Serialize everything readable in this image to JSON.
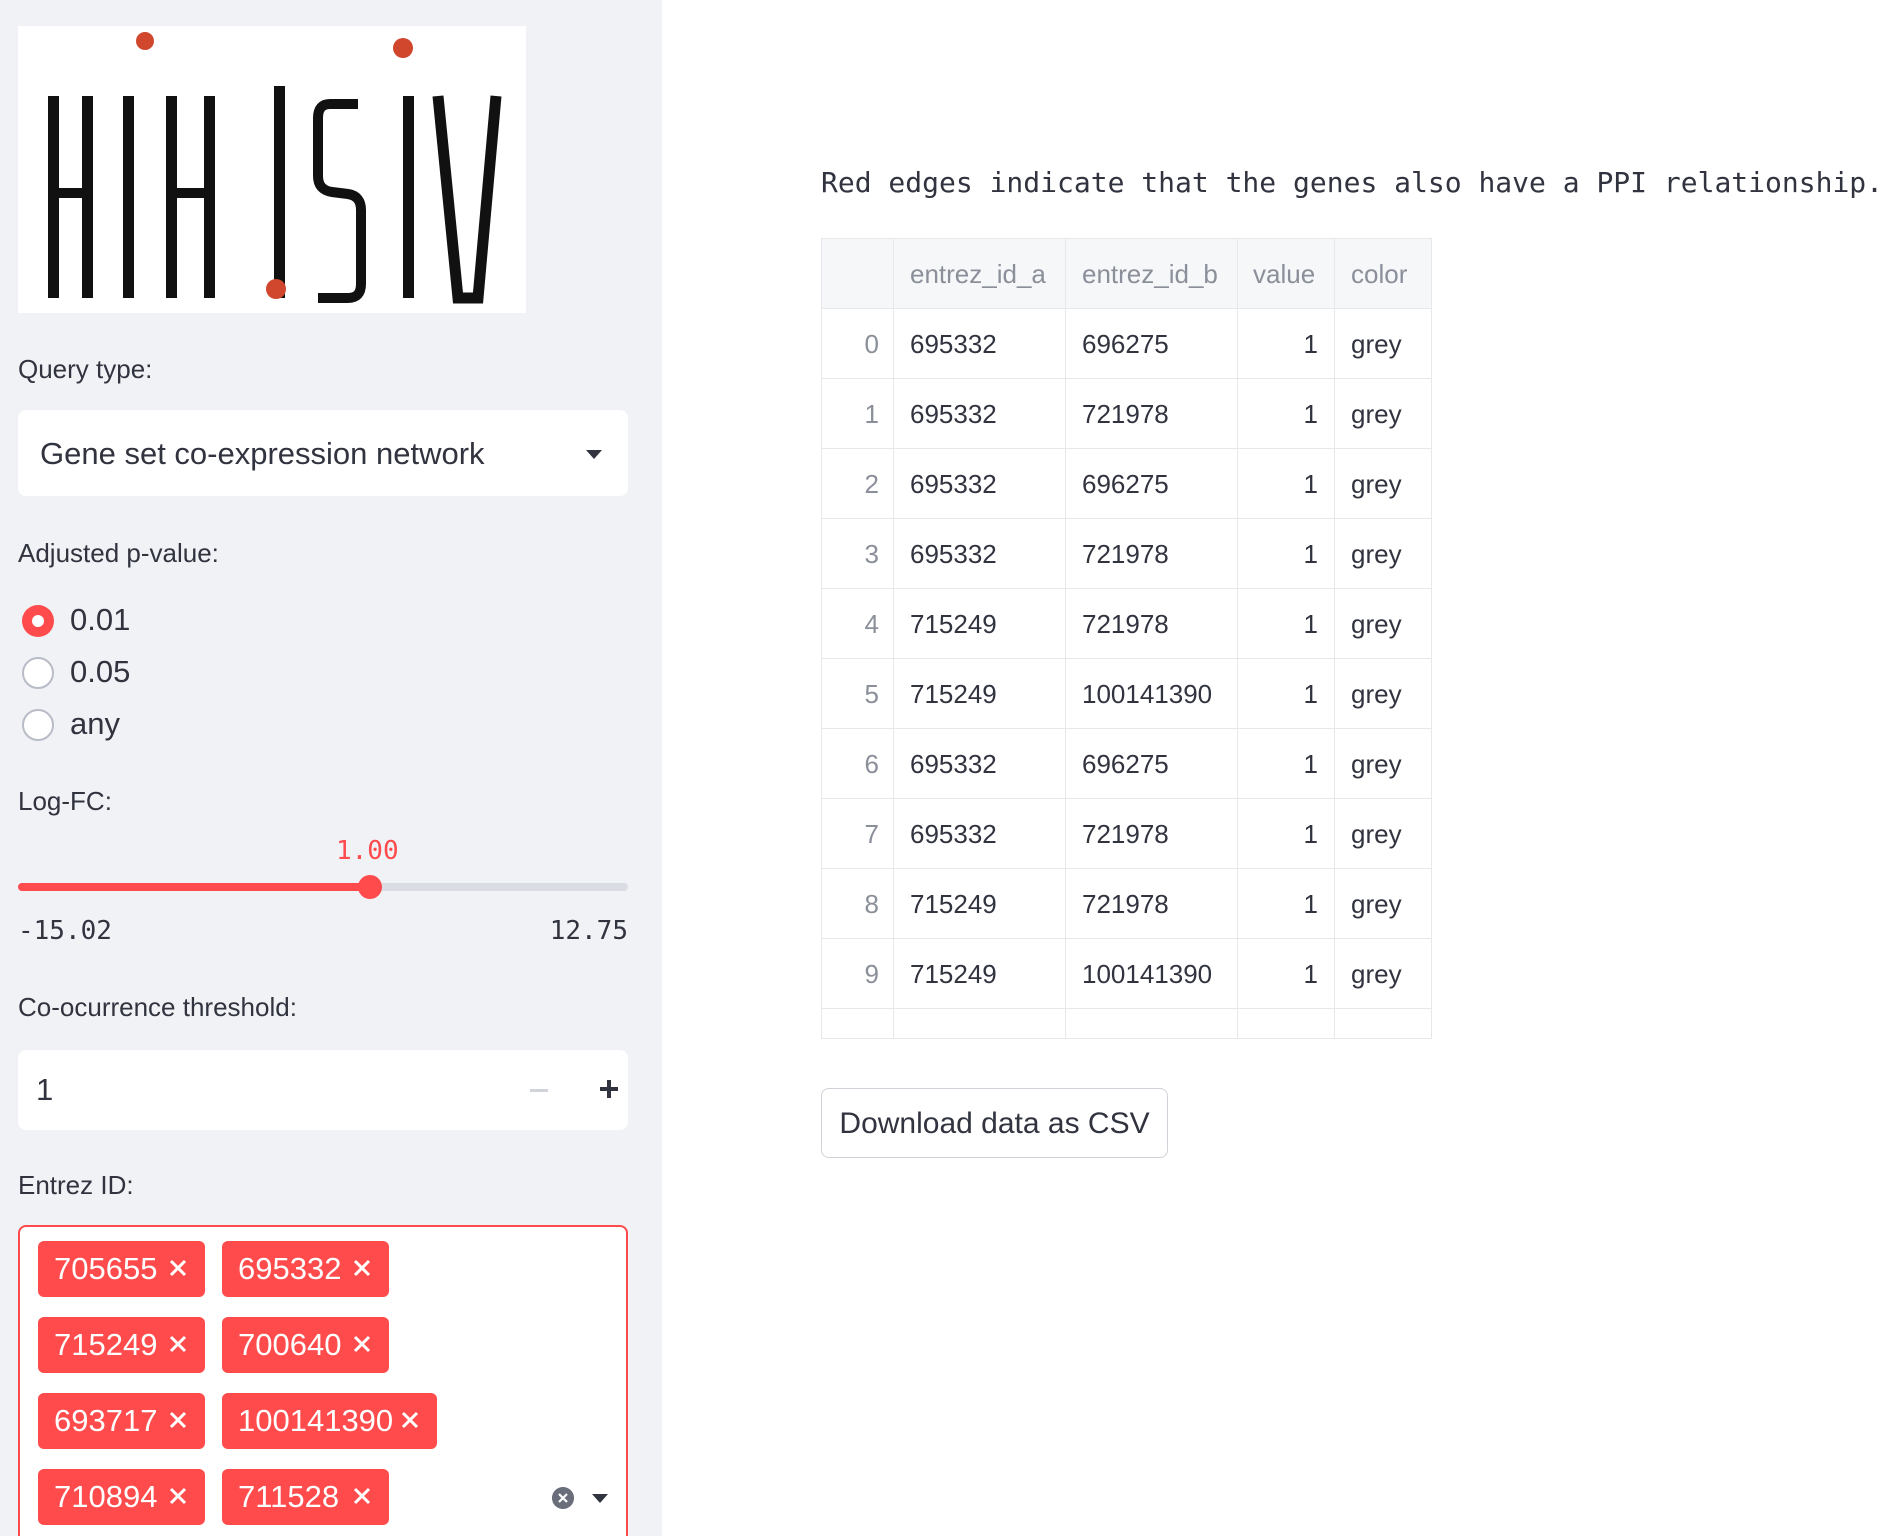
{
  "sidebar": {
    "logo_text": "HIHISIV",
    "query_type_label": "Query type:",
    "query_type_value": "Gene set co-expression network",
    "pvalue_label": "Adjusted p-value:",
    "pvalue_options": [
      "0.01",
      "0.05",
      "any"
    ],
    "pvalue_selected": "0.01",
    "logfc_label": "Log-FC:",
    "logfc_value": "1.00",
    "logfc_min": "-15.02",
    "logfc_max": "12.75",
    "cooc_label": "Co-ocurrence threshold:",
    "cooc_value": "1",
    "entrez_label": "Entrez ID:",
    "entrez_tags": [
      "705655",
      "695332",
      "715249",
      "700640",
      "693717",
      "100141390",
      "710894",
      "711528"
    ]
  },
  "main": {
    "description": "Red edges indicate that the genes also have a PPI relationship.",
    "table": {
      "columns": [
        "",
        "entrez_id_a",
        "entrez_id_b",
        "value",
        "color"
      ],
      "rows": [
        [
          "0",
          "695332",
          "696275",
          "1",
          "grey"
        ],
        [
          "1",
          "695332",
          "721978",
          "1",
          "grey"
        ],
        [
          "2",
          "695332",
          "696275",
          "1",
          "grey"
        ],
        [
          "3",
          "695332",
          "721978",
          "1",
          "grey"
        ],
        [
          "4",
          "715249",
          "721978",
          "1",
          "grey"
        ],
        [
          "5",
          "715249",
          "100141390",
          "1",
          "grey"
        ],
        [
          "6",
          "695332",
          "696275",
          "1",
          "grey"
        ],
        [
          "7",
          "695332",
          "721978",
          "1",
          "grey"
        ],
        [
          "8",
          "715249",
          "721978",
          "1",
          "grey"
        ],
        [
          "9",
          "715249",
          "100141390",
          "1",
          "grey"
        ]
      ]
    },
    "download_label": "Download data as CSV"
  },
  "colors": {
    "accent": "#ff4b4b",
    "sidebar_bg": "#f0f2f6",
    "text": "#31333f",
    "logo_dot": "#d0472e"
  },
  "icons": [
    "caret-down-icon",
    "close-icon",
    "clear-icon",
    "plus-icon",
    "minus-icon"
  ]
}
